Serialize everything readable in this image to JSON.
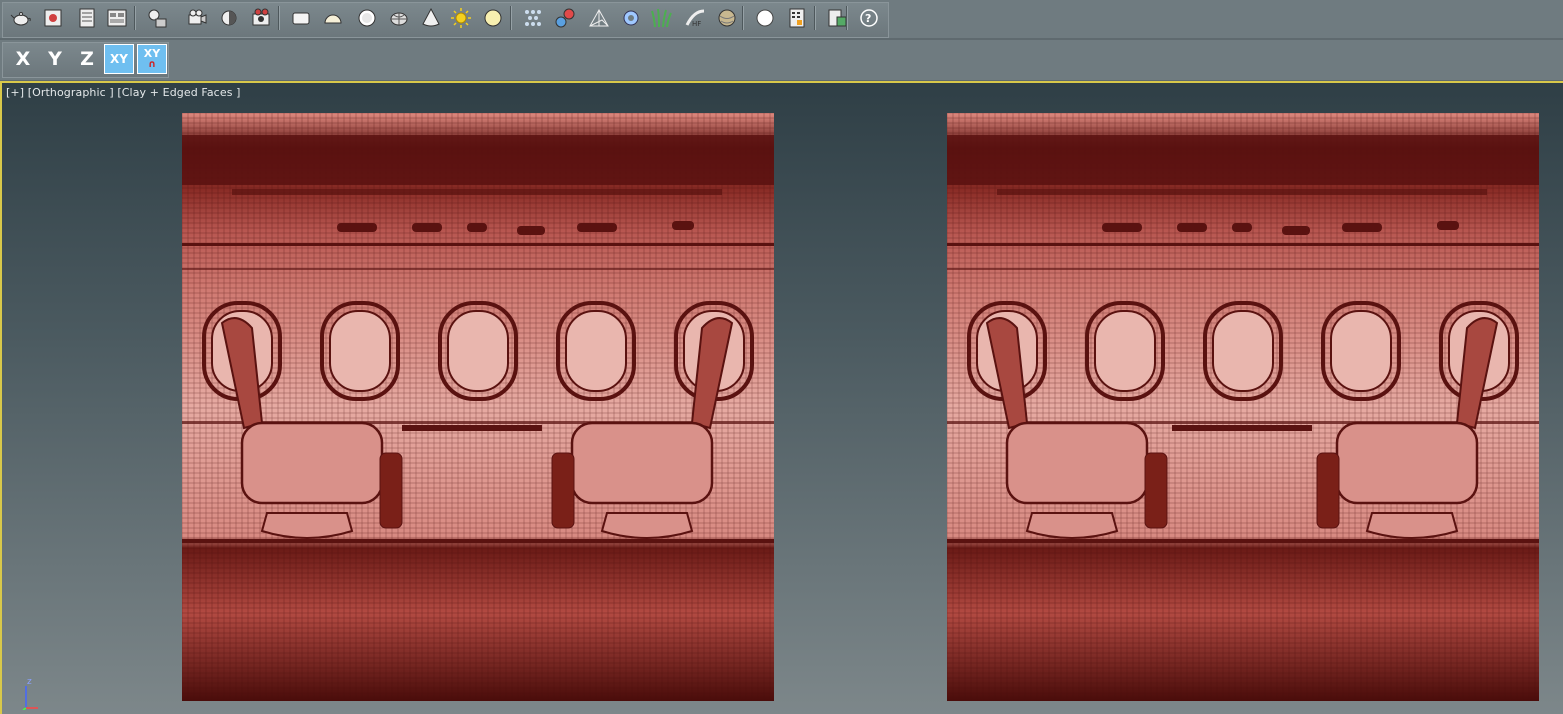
{
  "toolbar_main": {
    "buttons": [
      {
        "name": "teapot-icon"
      },
      {
        "name": "render-frame-icon"
      },
      {
        "name": "render-setup-icon"
      },
      {
        "name": "rendered-frame-window-icon"
      },
      {
        "name": "material-editor-icon"
      },
      {
        "name": "camera-icon"
      },
      {
        "name": "light-icon"
      },
      {
        "name": "render-production-icon"
      },
      {
        "name": "box-shape-icon"
      },
      {
        "name": "dome-shape-icon"
      },
      {
        "name": "sphere-shape-icon"
      },
      {
        "name": "teapot-wire-icon"
      },
      {
        "name": "cone-shape-icon"
      },
      {
        "name": "sun-icon"
      },
      {
        "name": "sky-light-icon"
      },
      {
        "name": "particle-grid-icon"
      },
      {
        "name": "molecule-icon"
      },
      {
        "name": "pyramid-wire-icon"
      },
      {
        "name": "gear-icon"
      },
      {
        "name": "grass-icon"
      },
      {
        "name": "hair-brush-icon"
      },
      {
        "name": "texture-ball-icon"
      },
      {
        "name": "white-sphere-icon"
      },
      {
        "name": "calculator-icon"
      },
      {
        "name": "document-export-icon"
      },
      {
        "name": "help-icon"
      }
    ]
  },
  "toolbar_axis": {
    "x_label": "X",
    "y_label": "Y",
    "z_label": "Z",
    "xy_label": "XY",
    "xy_ortho_label": "XY"
  },
  "viewport": {
    "label": "[+] [Orthographic ] [Clay + Edged Faces ]",
    "axis_z_label": "z",
    "colors": {
      "mesh_fill": "#c96a62",
      "mesh_dark": "#5a1210",
      "mesh_wire": "#4a0e0c",
      "border_active": "#d8c84a"
    }
  }
}
